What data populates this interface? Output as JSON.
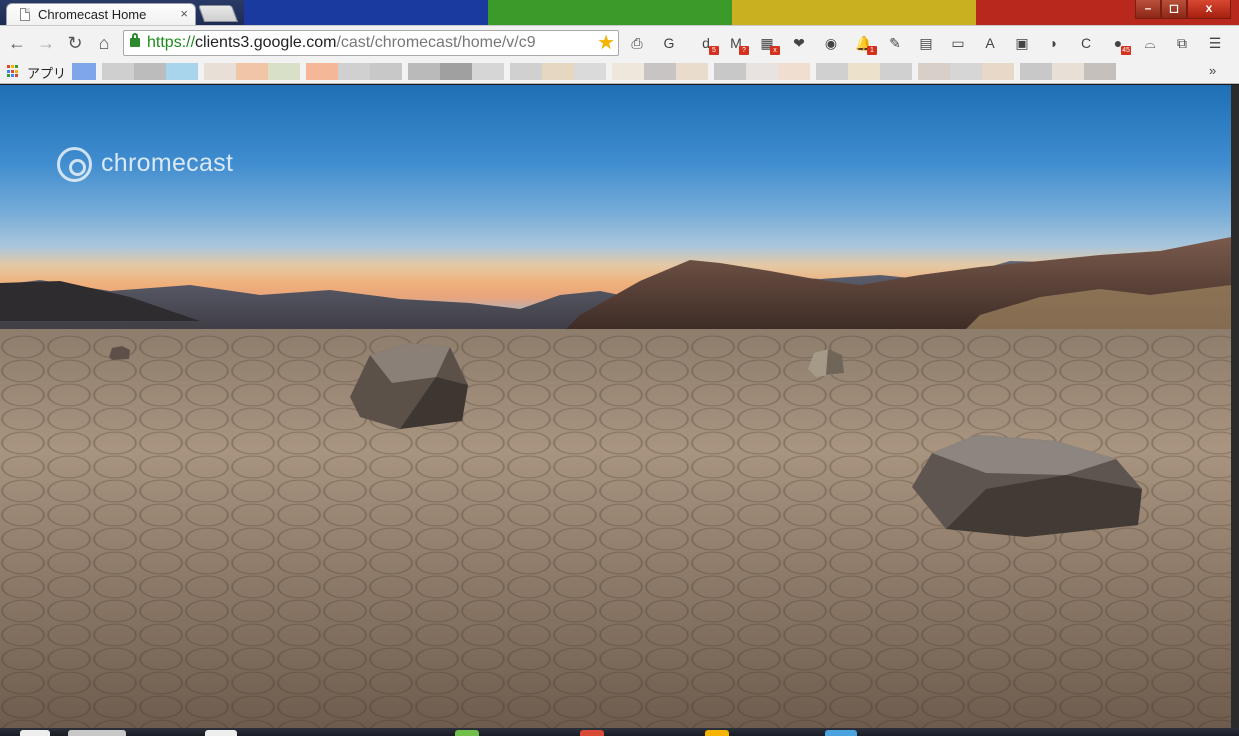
{
  "window": {
    "tab_title": "Chromecast Home",
    "tab_close": "×",
    "controls": {
      "minimize": "–",
      "maximize": "◻",
      "close": "x"
    }
  },
  "toolbar": {
    "back": "←",
    "forward": "→",
    "reload": "↻",
    "home": "⌂",
    "url_scheme": "https://",
    "url_host": "clients3.google.com",
    "url_path": "/cast/chromecast/home/v/c9",
    "bookmark_star": "★",
    "extensions": [
      {
        "name": "page-capture-icon",
        "glyph": "⎙",
        "badge": ""
      },
      {
        "name": "grammar-g-icon",
        "glyph": "G",
        "badge": ""
      },
      {
        "name": "digg-icon",
        "glyph": "d",
        "badge": "5"
      },
      {
        "name": "gmail-icon",
        "glyph": "M",
        "badge": "?"
      },
      {
        "name": "calendar-icon",
        "glyph": "▦",
        "badge": "x"
      },
      {
        "name": "pocket-icon",
        "glyph": "❤",
        "badge": ""
      },
      {
        "name": "color-picker-icon",
        "glyph": "◉",
        "badge": ""
      },
      {
        "name": "notification-bell-icon",
        "glyph": "🔔",
        "badge": "1"
      },
      {
        "name": "pin-icon",
        "glyph": "✎",
        "badge": ""
      },
      {
        "name": "chart-icon",
        "glyph": "▤",
        "badge": ""
      },
      {
        "name": "ruler-icon",
        "glyph": "▭",
        "badge": ""
      },
      {
        "name": "translate-icon",
        "glyph": "A",
        "badge": ""
      },
      {
        "name": "screenshot-icon",
        "glyph": "▣",
        "badge": ""
      },
      {
        "name": "speech-bubble-icon",
        "glyph": "◗",
        "badge": ""
      },
      {
        "name": "c-extension-icon",
        "glyph": "C",
        "badge": ""
      },
      {
        "name": "green-counter-icon",
        "glyph": "●",
        "badge": "45"
      },
      {
        "name": "incognito-icon",
        "glyph": "⌓",
        "badge": ""
      },
      {
        "name": "cast-icon",
        "glyph": "⧉",
        "badge": ""
      },
      {
        "name": "menu-icon",
        "glyph": "☰",
        "badge": ""
      }
    ]
  },
  "bookmarks": {
    "apps_label": "アプリ",
    "more": "»"
  },
  "content": {
    "logo_text": "chromecast"
  },
  "colors": {
    "tab_stripes": [
      "#1b3aa0",
      "#3b9a2a",
      "#c9b020",
      "#b8281c"
    ],
    "apps_grid": [
      "#d84a38",
      "#f4b400",
      "#3b9a2a",
      "#4285f4",
      "#d84a38",
      "#f4b400",
      "#3b9a2a",
      "#4285f4",
      "#d84a38"
    ],
    "bookmark_blocks": [
      "#7fa6e8",
      "#cfcfcf",
      "#bcbcbc",
      "#a8d4ec",
      "#e8e0d6",
      "#f0c6a6",
      "#d8e0c8",
      "#f4b898",
      "#d0d0d0",
      "#c8c8c8",
      "#bababa",
      "#a0a0a0",
      "#d6d6d6",
      "#d0d0d0",
      "#e6d8c0",
      "#dadada",
      "#efe6dc",
      "#c9c4c4",
      "#eadccc",
      "#c8c8c8",
      "#e8e2e0",
      "#f0ded0",
      "#d0d0d0",
      "#ece2cc",
      "#d0d0d0",
      "#d8d0c8",
      "#d6d6d6",
      "#e8d8c8",
      "#c8c8c8",
      "#e8e0d6",
      "#c6c0bc"
    ]
  }
}
